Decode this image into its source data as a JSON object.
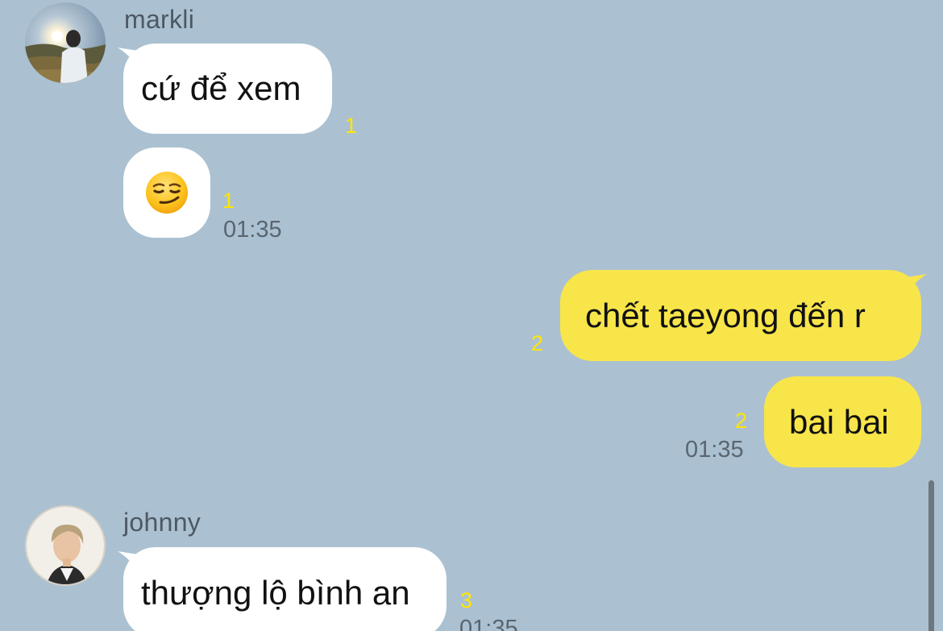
{
  "thread": {
    "messages": [
      {
        "sender": "markli",
        "direction": "incoming",
        "bubbles": [
          {
            "text": "cứ để xem",
            "unread": "1"
          },
          {
            "emoji": "smirking-face",
            "unread": "1",
            "time": "01:35"
          }
        ]
      },
      {
        "sender": "me",
        "direction": "outgoing",
        "bubbles": [
          {
            "text": "chết taeyong đến r",
            "unread": "2"
          },
          {
            "text": "bai bai",
            "unread": "2",
            "time": "01:35"
          }
        ]
      },
      {
        "sender": "johnny",
        "direction": "incoming",
        "bubbles": [
          {
            "text": "thượng lộ bình an",
            "unread": "3",
            "time": "01:35"
          }
        ]
      }
    ]
  },
  "colors": {
    "background": "#ABC1D1",
    "incoming_bubble": "#FFFFFF",
    "outgoing_bubble": "#F8E54A",
    "unread_count": "#FFE600",
    "timestamp": "#5A6570"
  },
  "icons": {
    "markli_avatar": "avatar-photo-sunset",
    "johnny_avatar": "avatar-photo-portrait",
    "emoji": "smirking-face"
  }
}
